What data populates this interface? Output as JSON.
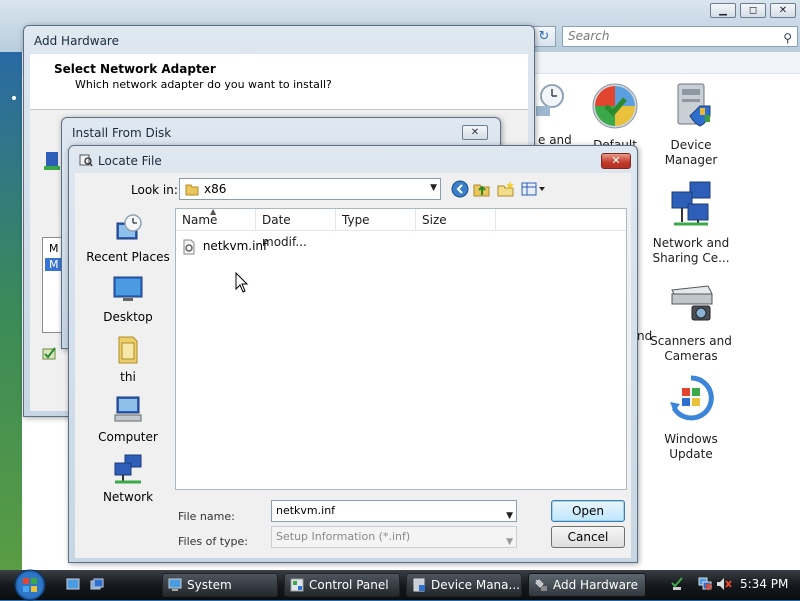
{
  "control_panel": {
    "search_placeholder": "Search",
    "items": [
      {
        "label": "Default Programs",
        "label_line1": "Default"
      },
      {
        "label": "Device Manager",
        "label_line1": "Device",
        "label_line2": "Manager"
      },
      {
        "label": "Network and Sharing Ce...",
        "label_line1": "Network and",
        "label_line2": "Sharing Ce..."
      },
      {
        "label": "Scanners and Cameras",
        "label_line1": "Scanners and",
        "label_line2": "Cameras"
      },
      {
        "label": "Windows Update",
        "label_line1": "Windows",
        "label_line2": "Update"
      }
    ],
    "partial_texts": [
      "e and",
      "nd"
    ]
  },
  "add_hardware": {
    "title": "Add Hardware",
    "heading": "Select Network Adapter",
    "subheading": "Which network adapter do you want to install?",
    "list_items": [
      "M",
      "M"
    ]
  },
  "install_from_disk": {
    "title": "Install From Disk",
    "close_label": "✕"
  },
  "locate_file": {
    "title": "Locate File",
    "close_label": "✕",
    "look_in_label": "Look in:",
    "look_in_value": "x86",
    "places": [
      {
        "label": "Recent Places",
        "icon": "recent-places-icon"
      },
      {
        "label": "Desktop",
        "icon": "desktop-icon"
      },
      {
        "label": "thi",
        "icon": "user-folder-icon"
      },
      {
        "label": "Computer",
        "icon": "computer-icon"
      },
      {
        "label": "Network",
        "icon": "network-icon"
      }
    ],
    "columns": [
      "Name",
      "Date modif...",
      "Type",
      "Size"
    ],
    "files": [
      {
        "name": "netkvm.inf",
        "icon": "inf-file-icon"
      }
    ],
    "file_name_label": "File name:",
    "file_name_value": "netkvm.inf",
    "files_of_type_label": "Files of type:",
    "files_of_type_value": "Setup Information (*.inf)",
    "open_label": "Open",
    "cancel_label": "Cancel"
  },
  "taskbar": {
    "buttons": [
      {
        "label": "System",
        "active": false
      },
      {
        "label": "Control Panel",
        "active": false
      },
      {
        "label": "Device Mana...",
        "active": false
      },
      {
        "label": "Add Hardware",
        "active": true
      }
    ],
    "clock": "5:34 PM"
  },
  "colors": {
    "taskbar": "#15191d",
    "dialog_frame": "#c7d6e4",
    "close_red": "#c1392a",
    "open_button": "#bee6fd"
  }
}
